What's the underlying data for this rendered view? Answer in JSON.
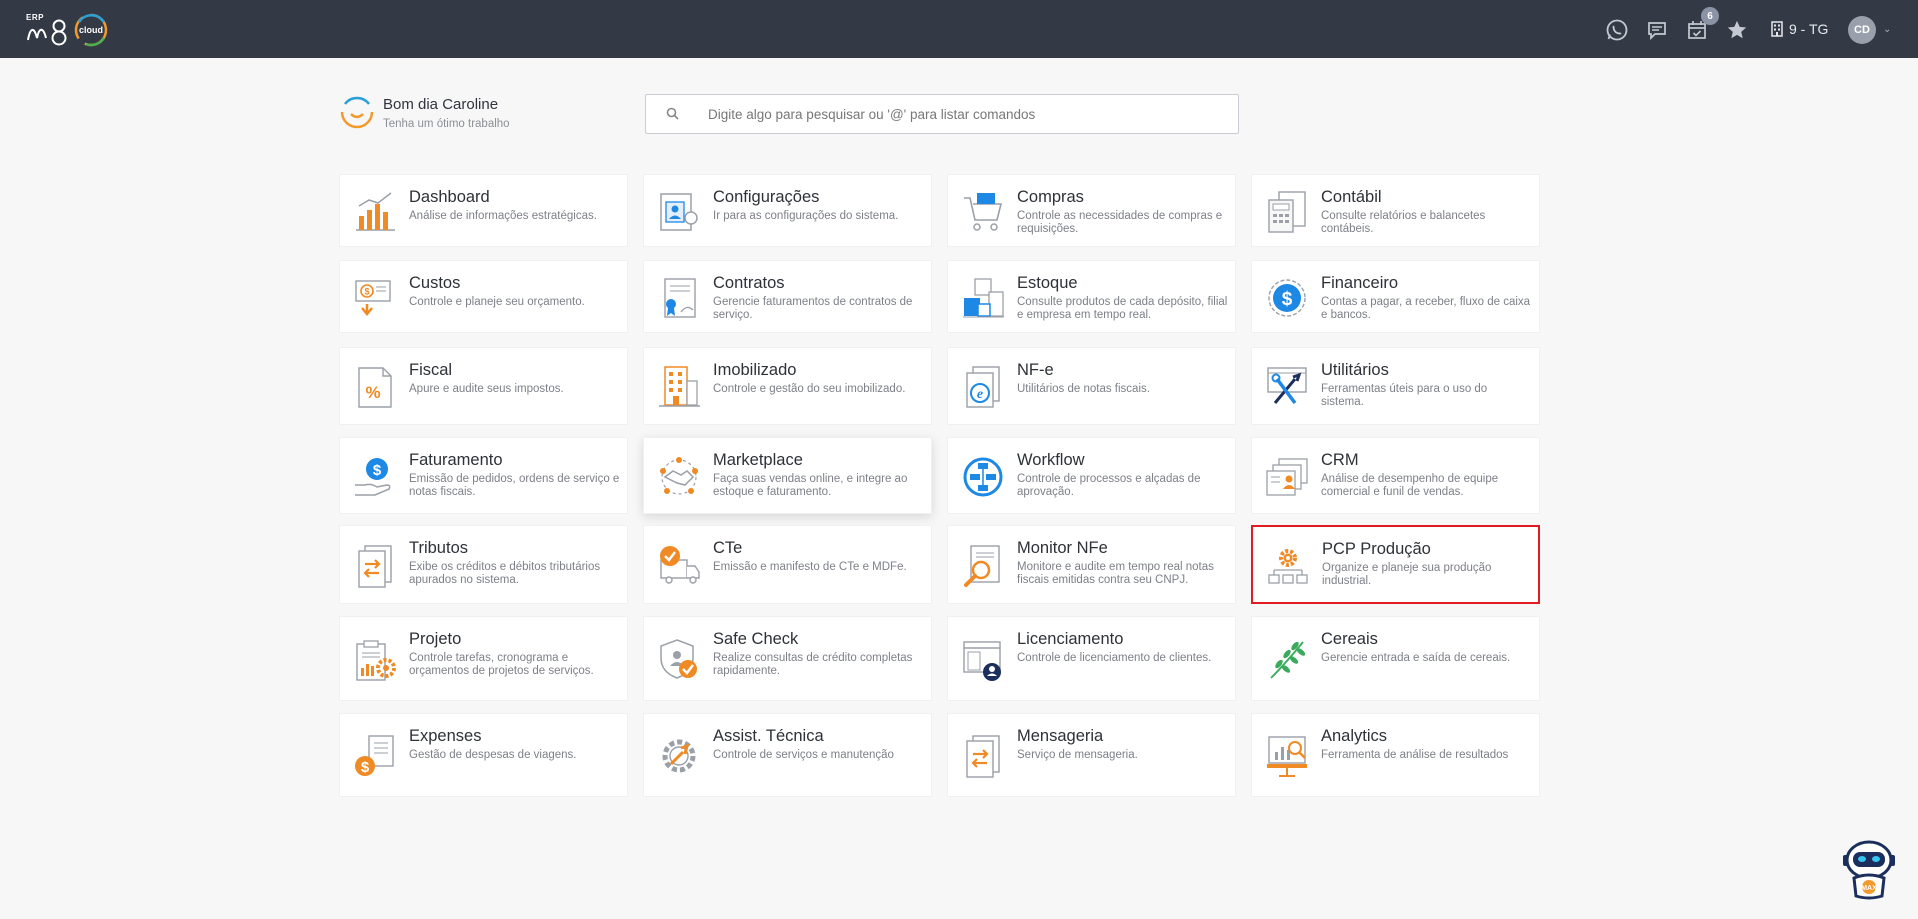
{
  "header": {
    "logo_erp": "ERP",
    "logo_cloud": "cloud",
    "notification_count": "6",
    "company": "9 - TG",
    "user_initials": "CD"
  },
  "greeting": {
    "title": "Bom dia Caroline",
    "subtitle": "Tenha um ótimo trabalho"
  },
  "search": {
    "placeholder": "Digite algo para pesquisar ou '@' para listar comandos"
  },
  "colors": {
    "topbar": "#343a45",
    "accent_orange": "#f08a24",
    "accent_blue": "#1e88e5",
    "selected_border": "#e11b22"
  },
  "modules": [
    {
      "title": "Dashboard",
      "desc": "Análise de informações estratégicas.",
      "icon": "bar-chart-icon"
    },
    {
      "title": "Configurações",
      "desc": "Ir para as configurações do sistema.",
      "icon": "settings-profile-icon"
    },
    {
      "title": "Compras",
      "desc": "Controle as necessidades de compras e requisições.",
      "icon": "shopping-cart-icon"
    },
    {
      "title": "Contábil",
      "desc": "Consulte relatórios e balancetes contábeis.",
      "icon": "calculator-icon"
    },
    {
      "title": "Custos",
      "desc": "Controle e planeje seu orçamento.",
      "icon": "money-down-icon"
    },
    {
      "title": "Contratos",
      "desc": "Gerencie faturamentos de contratos de serviço.",
      "icon": "contract-icon"
    },
    {
      "title": "Estoque",
      "desc": "Consulte produtos de cada depósito, filial e empresa em tempo real.",
      "icon": "warehouse-icon"
    },
    {
      "title": "Financeiro",
      "desc": "Contas a pagar, a receber, fluxo de caixa e bancos.",
      "icon": "dollar-circle-icon"
    },
    {
      "title": "Fiscal",
      "desc": "Apure e audite seus impostos.",
      "icon": "percent-document-icon"
    },
    {
      "title": "Imobilizado",
      "desc": "Controle e gestão do seu imobilizado.",
      "icon": "building-icon"
    },
    {
      "title": "NF-e",
      "desc": "Utilitários de notas fiscais.",
      "icon": "nfe-document-icon"
    },
    {
      "title": "Utilitários",
      "desc": "Ferramentas úteis para o uso do sistema.",
      "icon": "tools-icon"
    },
    {
      "title": "Faturamento",
      "desc": "Emissão de pedidos, ordens de serviço e notas fiscais.",
      "icon": "hand-dollar-icon"
    },
    {
      "title": "Marketplace",
      "desc": "Faça suas vendas online, e integre ao estoque e faturamento.",
      "icon": "handshake-icon"
    },
    {
      "title": "Workflow",
      "desc": "Controle de processos e alçadas de aprovação.",
      "icon": "workflow-icon"
    },
    {
      "title": "CRM",
      "desc": "Análise de desempenho de equipe comercial e funil de vendas.",
      "icon": "crm-cards-icon"
    },
    {
      "title": "Tributos",
      "desc": "Exibe os créditos e débitos tributários apurados no sistema.",
      "icon": "transfer-document-icon"
    },
    {
      "title": "CTe",
      "desc": "Emissão e manifesto de CTe e MDFe.",
      "icon": "truck-check-icon"
    },
    {
      "title": "Monitor NFe",
      "desc": "Monitore e audite em tempo real notas fiscais emitidas contra seu CNPJ.",
      "icon": "magnifier-document-icon"
    },
    {
      "title": "PCP Produção",
      "desc": "Organize e planeje sua produção industrial.",
      "icon": "production-gear-icon"
    },
    {
      "title": "Projeto",
      "desc": "Controle tarefas, cronograma e orçamentos de projetos de serviços.",
      "icon": "project-clipboard-icon"
    },
    {
      "title": "Safe Check",
      "desc": "Realize consultas de crédito completas rapidamente.",
      "icon": "shield-check-icon"
    },
    {
      "title": "Licenciamento",
      "desc": "Controle de licenciamento de clientes.",
      "icon": "license-icon"
    },
    {
      "title": "Cereais",
      "desc": "Gerencie entrada e saída de cereais.",
      "icon": "wheat-icon"
    },
    {
      "title": "Expenses",
      "desc": "Gestão de despesas de viagens.",
      "icon": "expenses-icon"
    },
    {
      "title": "Assist. Técnica",
      "desc": "Controle de serviços e manutenção",
      "icon": "gear-wrench-icon"
    },
    {
      "title": "Mensageria",
      "desc": "Serviço de mensageria.",
      "icon": "message-transfer-icon"
    },
    {
      "title": "Analytics",
      "desc": "Ferramenta de análise de resultados",
      "icon": "analytics-board-icon"
    }
  ]
}
